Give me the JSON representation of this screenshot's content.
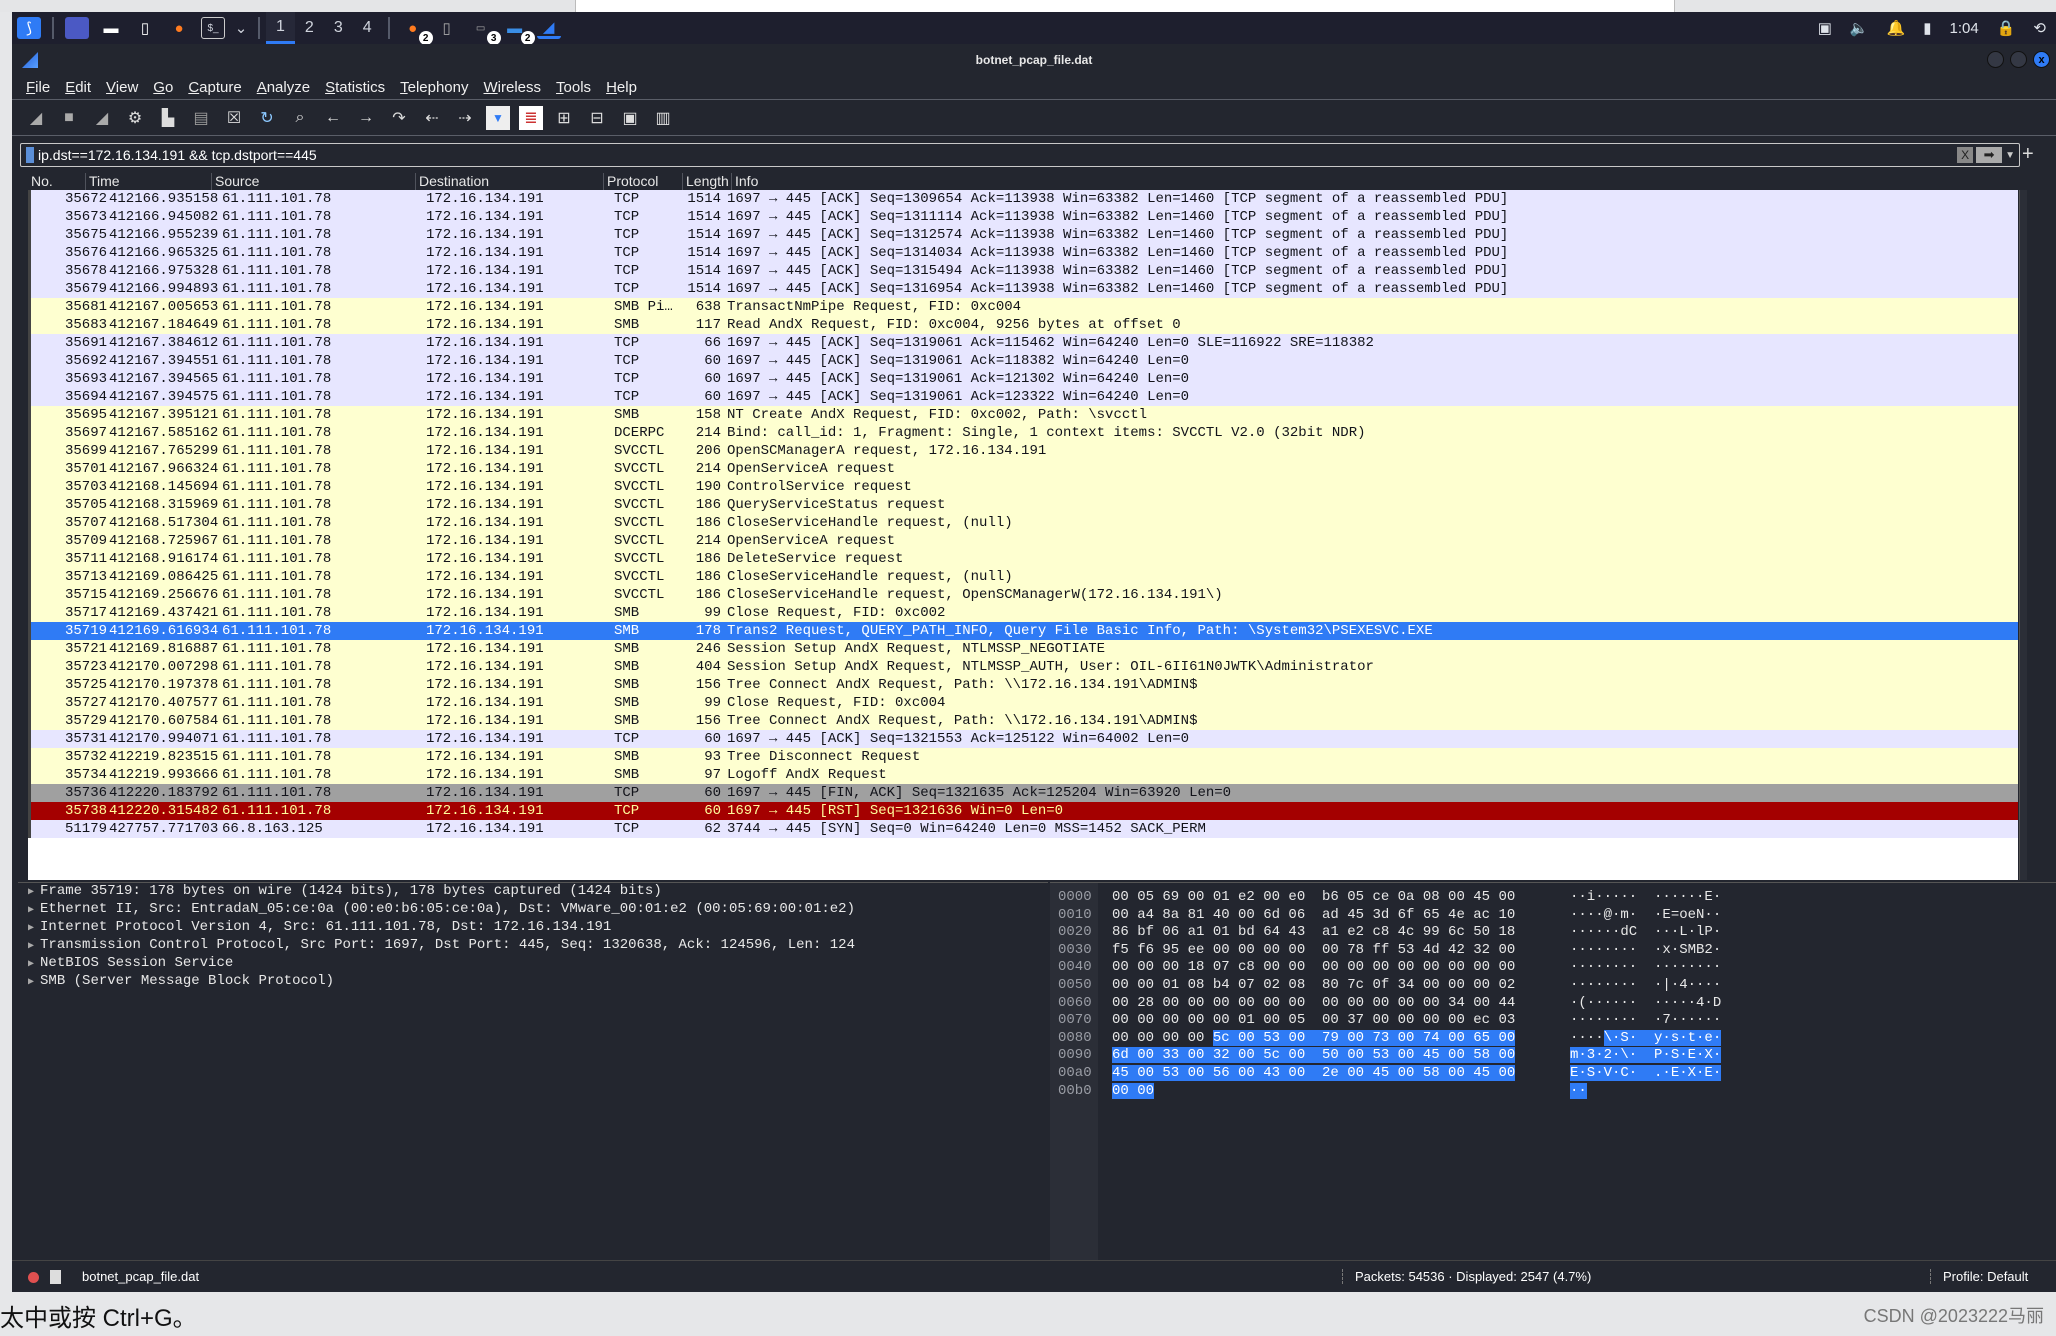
{
  "taskbar": {
    "workspaces": [
      "1",
      "2",
      "3",
      "4"
    ],
    "active_workspace": "1",
    "badges": [
      "2",
      "3",
      "2"
    ],
    "clock": "1:04"
  },
  "window": {
    "title": "botnet_pcap_file.dat"
  },
  "menu": [
    "File",
    "Edit",
    "View",
    "Go",
    "Capture",
    "Analyze",
    "Statistics",
    "Telephony",
    "Wireless",
    "Tools",
    "Help"
  ],
  "toolbar": {
    "icons": [
      "start-capture-icon",
      "stop-capture-icon",
      "restart-capture-icon",
      "capture-options-icon",
      "open-file-icon",
      "save-file-icon",
      "close-file-icon",
      "reload-file-icon",
      "find-packet-icon",
      "go-back-icon",
      "go-forward-icon",
      "go-to-packet-icon",
      "go-first-icon",
      "go-last-icon",
      "autoscroll-icon",
      "colorize-icon",
      "zoom-in-icon",
      "zoom-out-icon",
      "normal-size-icon",
      "resize-columns-icon"
    ]
  },
  "filter": {
    "value": "ip.dst==172.16.134.191 && tcp.dstport==445",
    "clear": "X",
    "apply": "➡",
    "add": "+"
  },
  "columns": [
    "No.",
    "Time",
    "Source",
    "Destination",
    "Protocol",
    "Length",
    "Info"
  ],
  "packets": [
    {
      "no": "35672",
      "time": "412166.935158",
      "src": "61.111.101.78",
      "dst": "172.16.134.191",
      "proto": "TCP",
      "len": "1514",
      "info": "1697 → 445 [ACK] Seq=1309654 Ack=113938 Win=63382 Len=1460 [TCP segment of a reassembled PDU]",
      "kind": "tcp"
    },
    {
      "no": "35673",
      "time": "412166.945082",
      "src": "61.111.101.78",
      "dst": "172.16.134.191",
      "proto": "TCP",
      "len": "1514",
      "info": "1697 → 445 [ACK] Seq=1311114 Ack=113938 Win=63382 Len=1460 [TCP segment of a reassembled PDU]",
      "kind": "tcp"
    },
    {
      "no": "35675",
      "time": "412166.955239",
      "src": "61.111.101.78",
      "dst": "172.16.134.191",
      "proto": "TCP",
      "len": "1514",
      "info": "1697 → 445 [ACK] Seq=1312574 Ack=113938 Win=63382 Len=1460 [TCP segment of a reassembled PDU]",
      "kind": "tcp"
    },
    {
      "no": "35676",
      "time": "412166.965325",
      "src": "61.111.101.78",
      "dst": "172.16.134.191",
      "proto": "TCP",
      "len": "1514",
      "info": "1697 → 445 [ACK] Seq=1314034 Ack=113938 Win=63382 Len=1460 [TCP segment of a reassembled PDU]",
      "kind": "tcp"
    },
    {
      "no": "35678",
      "time": "412166.975328",
      "src": "61.111.101.78",
      "dst": "172.16.134.191",
      "proto": "TCP",
      "len": "1514",
      "info": "1697 → 445 [ACK] Seq=1315494 Ack=113938 Win=63382 Len=1460 [TCP segment of a reassembled PDU]",
      "kind": "tcp"
    },
    {
      "no": "35679",
      "time": "412166.994893",
      "src": "61.111.101.78",
      "dst": "172.16.134.191",
      "proto": "TCP",
      "len": "1514",
      "info": "1697 → 445 [ACK] Seq=1316954 Ack=113938 Win=63382 Len=1460 [TCP segment of a reassembled PDU]",
      "kind": "tcp"
    },
    {
      "no": "35681",
      "time": "412167.005653",
      "src": "61.111.101.78",
      "dst": "172.16.134.191",
      "proto": "SMB Pi…",
      "len": "638",
      "info": "TransactNmPipe Request, FID: 0xc004",
      "kind": "smb"
    },
    {
      "no": "35683",
      "time": "412167.184649",
      "src": "61.111.101.78",
      "dst": "172.16.134.191",
      "proto": "SMB",
      "len": "117",
      "info": "Read AndX Request, FID: 0xc004, 9256 bytes at offset 0",
      "kind": "smb"
    },
    {
      "no": "35691",
      "time": "412167.384612",
      "src": "61.111.101.78",
      "dst": "172.16.134.191",
      "proto": "TCP",
      "len": "66",
      "info": "1697 → 445 [ACK] Seq=1319061 Ack=115462 Win=64240 Len=0 SLE=116922 SRE=118382",
      "kind": "tcp"
    },
    {
      "no": "35692",
      "time": "412167.394551",
      "src": "61.111.101.78",
      "dst": "172.16.134.191",
      "proto": "TCP",
      "len": "60",
      "info": "1697 → 445 [ACK] Seq=1319061 Ack=118382 Win=64240 Len=0",
      "kind": "tcp"
    },
    {
      "no": "35693",
      "time": "412167.394565",
      "src": "61.111.101.78",
      "dst": "172.16.134.191",
      "proto": "TCP",
      "len": "60",
      "info": "1697 → 445 [ACK] Seq=1319061 Ack=121302 Win=64240 Len=0",
      "kind": "tcp"
    },
    {
      "no": "35694",
      "time": "412167.394575",
      "src": "61.111.101.78",
      "dst": "172.16.134.191",
      "proto": "TCP",
      "len": "60",
      "info": "1697 → 445 [ACK] Seq=1319061 Ack=123322 Win=64240 Len=0",
      "kind": "tcp"
    },
    {
      "no": "35695",
      "time": "412167.395121",
      "src": "61.111.101.78",
      "dst": "172.16.134.191",
      "proto": "SMB",
      "len": "158",
      "info": "NT Create AndX Request, FID: 0xc002, Path: \\svcctl",
      "kind": "smb"
    },
    {
      "no": "35697",
      "time": "412167.585162",
      "src": "61.111.101.78",
      "dst": "172.16.134.191",
      "proto": "DCERPC",
      "len": "214",
      "info": "Bind: call_id: 1, Fragment: Single, 1 context items: SVCCTL V2.0 (32bit NDR)",
      "kind": "smb"
    },
    {
      "no": "35699",
      "time": "412167.765299",
      "src": "61.111.101.78",
      "dst": "172.16.134.191",
      "proto": "SVCCTL",
      "len": "206",
      "info": "OpenSCManagerA request, 172.16.134.191",
      "kind": "smb"
    },
    {
      "no": "35701",
      "time": "412167.966324",
      "src": "61.111.101.78",
      "dst": "172.16.134.191",
      "proto": "SVCCTL",
      "len": "214",
      "info": "OpenServiceA request",
      "kind": "smb"
    },
    {
      "no": "35703",
      "time": "412168.145694",
      "src": "61.111.101.78",
      "dst": "172.16.134.191",
      "proto": "SVCCTL",
      "len": "190",
      "info": "ControlService request",
      "kind": "smb"
    },
    {
      "no": "35705",
      "time": "412168.315969",
      "src": "61.111.101.78",
      "dst": "172.16.134.191",
      "proto": "SVCCTL",
      "len": "186",
      "info": "QueryServiceStatus request",
      "kind": "smb"
    },
    {
      "no": "35707",
      "time": "412168.517304",
      "src": "61.111.101.78",
      "dst": "172.16.134.191",
      "proto": "SVCCTL",
      "len": "186",
      "info": "CloseServiceHandle request, (null)",
      "kind": "smb"
    },
    {
      "no": "35709",
      "time": "412168.725967",
      "src": "61.111.101.78",
      "dst": "172.16.134.191",
      "proto": "SVCCTL",
      "len": "214",
      "info": "OpenServiceA request",
      "kind": "smb"
    },
    {
      "no": "35711",
      "time": "412168.916174",
      "src": "61.111.101.78",
      "dst": "172.16.134.191",
      "proto": "SVCCTL",
      "len": "186",
      "info": "DeleteService request",
      "kind": "smb"
    },
    {
      "no": "35713",
      "time": "412169.086425",
      "src": "61.111.101.78",
      "dst": "172.16.134.191",
      "proto": "SVCCTL",
      "len": "186",
      "info": "CloseServiceHandle request, (null)",
      "kind": "smb"
    },
    {
      "no": "35715",
      "time": "412169.256676",
      "src": "61.111.101.78",
      "dst": "172.16.134.191",
      "proto": "SVCCTL",
      "len": "186",
      "info": "CloseServiceHandle request, OpenSCManagerW(172.16.134.191\\)",
      "kind": "smb"
    },
    {
      "no": "35717",
      "time": "412169.437421",
      "src": "61.111.101.78",
      "dst": "172.16.134.191",
      "proto": "SMB",
      "len": "99",
      "info": "Close Request, FID: 0xc002",
      "kind": "smb"
    },
    {
      "no": "35719",
      "time": "412169.616934",
      "src": "61.111.101.78",
      "dst": "172.16.134.191",
      "proto": "SMB",
      "len": "178",
      "info": "Trans2 Request, QUERY_PATH_INFO, Query File Basic Info, Path: \\System32\\PSEXESVC.EXE",
      "kind": "sel"
    },
    {
      "no": "35721",
      "time": "412169.816887",
      "src": "61.111.101.78",
      "dst": "172.16.134.191",
      "proto": "SMB",
      "len": "246",
      "info": "Session Setup AndX Request, NTLMSSP_NEGOTIATE",
      "kind": "smb"
    },
    {
      "no": "35723",
      "time": "412170.007298",
      "src": "61.111.101.78",
      "dst": "172.16.134.191",
      "proto": "SMB",
      "len": "404",
      "info": "Session Setup AndX Request, NTLMSSP_AUTH, User: OIL-6II61N0JWTK\\Administrator",
      "kind": "smb"
    },
    {
      "no": "35725",
      "time": "412170.197378",
      "src": "61.111.101.78",
      "dst": "172.16.134.191",
      "proto": "SMB",
      "len": "156",
      "info": "Tree Connect AndX Request, Path: \\\\172.16.134.191\\ADMIN$",
      "kind": "smb"
    },
    {
      "no": "35727",
      "time": "412170.407577",
      "src": "61.111.101.78",
      "dst": "172.16.134.191",
      "proto": "SMB",
      "len": "99",
      "info": "Close Request, FID: 0xc004",
      "kind": "smb"
    },
    {
      "no": "35729",
      "time": "412170.607584",
      "src": "61.111.101.78",
      "dst": "172.16.134.191",
      "proto": "SMB",
      "len": "156",
      "info": "Tree Connect AndX Request, Path: \\\\172.16.134.191\\ADMIN$",
      "kind": "smb"
    },
    {
      "no": "35731",
      "time": "412170.994071",
      "src": "61.111.101.78",
      "dst": "172.16.134.191",
      "proto": "TCP",
      "len": "60",
      "info": "1697 → 445 [ACK] Seq=1321553 Ack=125122 Win=64002 Len=0",
      "kind": "tcp"
    },
    {
      "no": "35732",
      "time": "412219.823515",
      "src": "61.111.101.78",
      "dst": "172.16.134.191",
      "proto": "SMB",
      "len": "93",
      "info": "Tree Disconnect Request",
      "kind": "smb"
    },
    {
      "no": "35734",
      "time": "412219.993666",
      "src": "61.111.101.78",
      "dst": "172.16.134.191",
      "proto": "SMB",
      "len": "97",
      "info": "Logoff AndX Request",
      "kind": "smb"
    },
    {
      "no": "35736",
      "time": "412220.183792",
      "src": "61.111.101.78",
      "dst": "172.16.134.191",
      "proto": "TCP",
      "len": "60",
      "info": "1697 → 445 [FIN, ACK] Seq=1321635 Ack=125204 Win=63920 Len=0",
      "kind": "fin"
    },
    {
      "no": "35738",
      "time": "412220.315482",
      "src": "61.111.101.78",
      "dst": "172.16.134.191",
      "proto": "TCP",
      "len": "60",
      "info": "1697 → 445 [RST] Seq=1321636 Win=0 Len=0",
      "kind": "rst"
    },
    {
      "no": "51179",
      "time": "427757.771703",
      "src": "66.8.163.125",
      "dst": "172.16.134.191",
      "proto": "TCP",
      "len": "62",
      "info": "3744 → 445 [SYN] Seq=0 Win=64240 Len=0 MSS=1452 SACK_PERM",
      "kind": "tcp"
    }
  ],
  "details": [
    "Frame 35719: 178 bytes on wire (1424 bits), 178 bytes captured (1424 bits)",
    "Ethernet II, Src: EntradaN_05:ce:0a (00:e0:b6:05:ce:0a), Dst: VMware_00:01:e2 (00:05:69:00:01:e2)",
    "Internet Protocol Version 4, Src: 61.111.101.78, Dst: 172.16.134.191",
    "Transmission Control Protocol, Src Port: 1697, Dst Port: 445, Seq: 1320638, Ack: 124596, Len: 124",
    "NetBIOS Session Service",
    "SMB (Server Message Block Protocol)"
  ],
  "hex": [
    {
      "off": "0000",
      "bytes": "00 05 69 00 01 e2 00 e0  b6 05 ce 0a 08 00 45 00",
      "ascii": "··i·····  ······E·",
      "sel_from": -1
    },
    {
      "off": "0010",
      "bytes": "00 a4 8a 81 40 00 6d 06  ad 45 3d 6f 65 4e ac 10",
      "ascii": "····@·m·  ·E=oeN··",
      "sel_from": -1
    },
    {
      "off": "0020",
      "bytes": "86 bf 06 a1 01 bd 64 43  a1 e2 c8 4c 99 6c 50 18",
      "ascii": "······dC  ···L·lP·",
      "sel_from": -1
    },
    {
      "off": "0030",
      "bytes": "f5 f6 95 ee 00 00 00 00  00 78 ff 53 4d 42 32 00",
      "ascii": "········  ·x·SMB2·",
      "sel_from": -1
    },
    {
      "off": "0040",
      "bytes": "00 00 00 18 07 c8 00 00  00 00 00 00 00 00 00 00",
      "ascii": "········  ········",
      "sel_from": -1
    },
    {
      "off": "0050",
      "bytes": "00 00 01 08 b4 07 02 08  80 7c 0f 34 00 00 00 02",
      "ascii": "········  ·|·4····",
      "sel_from": -1
    },
    {
      "off": "0060",
      "bytes": "00 28 00 00 00 00 00 00  00 00 00 00 00 34 00 44",
      "ascii": "·(······  ·····4·D",
      "sel_from": -1
    },
    {
      "off": "0070",
      "bytes": "00 00 00 00 00 01 00 05  00 37 00 00 00 00 ec 03",
      "ascii": "········  ·7······",
      "sel_from": -1
    },
    {
      "off": "0080",
      "bytes": "00 00 00 00 5c 00 53 00  79 00 73 00 74 00 65 00",
      "ascii": "····\\·S·  y·s·t·e·",
      "sel_from": 4
    },
    {
      "off": "0090",
      "bytes": "6d 00 33 00 32 00 5c 00  50 00 53 00 45 00 58 00",
      "ascii": "m·3·2·\\·  P·S·E·X·",
      "sel_from": 0
    },
    {
      "off": "00a0",
      "bytes": "45 00 53 00 56 00 43 00  2e 00 45 00 58 00 45 00",
      "ascii": "E·S·V·C·  .·E·X·E·",
      "sel_from": 0
    },
    {
      "off": "00b0",
      "bytes": "00 00",
      "ascii": "··",
      "sel_from": 0
    }
  ],
  "status": {
    "file": "botnet_pcap_file.dat",
    "packets": "Packets: 54536 · Displayed: 2547 (4.7%)",
    "profile": "Profile: Default"
  },
  "bottom": {
    "hint_text": "太中或按 Ctrl+G。",
    "watermark": "CSDN @2023222马丽"
  },
  "colors": {
    "tcp_row": "#e7e6ff",
    "smb_row": "#feffd0",
    "selected": "#2f7bf5",
    "rst_row": "#a40000",
    "fin_row": "#a0a0a0"
  }
}
